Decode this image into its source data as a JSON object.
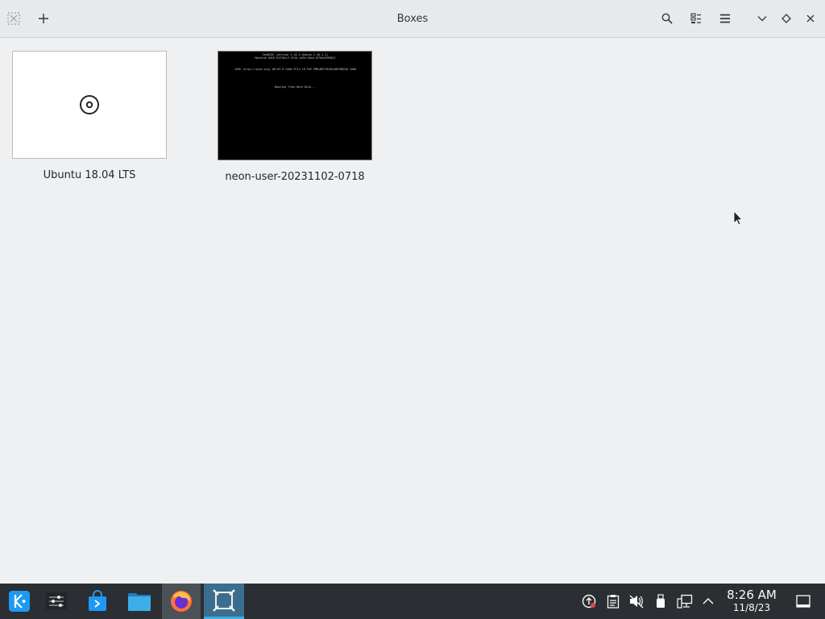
{
  "window": {
    "title": "Boxes"
  },
  "boxes": [
    {
      "name": "Ubuntu 18.04 LTS",
      "thumbnail": "disc-icon"
    },
    {
      "name": "neon-user-20231102-0718",
      "thumbnail": "terminal-screen",
      "screen_lines": [
        "SeaBIOS (version 1.16.2-debian-1.16.2-1)",
        "Machine UUID 61278ccf-5F44-4494-9dcb-079ee3599022",
        "",
        "",
        "iPXE (http://ipxe.org) 00:03.0 CA00 PCI2.10 PnP PMM+BEFCB250+BEF0B250 CA00",
        "",
        "",
        "",
        "",
        "Booting from Hard Disk..."
      ]
    }
  ],
  "clock": {
    "time": "8:26 AM",
    "date": "11/8/23"
  },
  "colors": {
    "accent": "#3daee9",
    "taskbar": "#2b2e32"
  }
}
